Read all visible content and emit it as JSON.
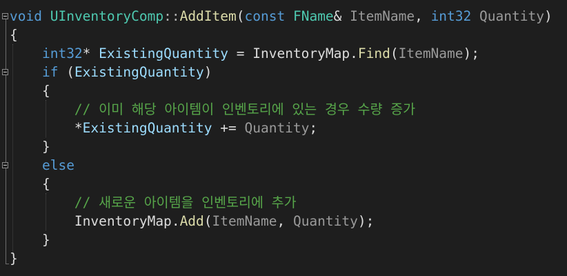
{
  "code_editor": {
    "lines": [
      {
        "tokens": [
          {
            "text": "void",
            "cls": "kw"
          },
          {
            "text": " ",
            "cls": "plain"
          },
          {
            "text": "UInventoryComp",
            "cls": "typ"
          },
          {
            "text": "::",
            "cls": "punc"
          },
          {
            "text": "AddItem",
            "cls": "fn"
          },
          {
            "text": "(",
            "cls": "plain"
          },
          {
            "text": "const",
            "cls": "kw"
          },
          {
            "text": " ",
            "cls": "plain"
          },
          {
            "text": "FName",
            "cls": "typ"
          },
          {
            "text": "& ",
            "cls": "plain"
          },
          {
            "text": "ItemName",
            "cls": "param"
          },
          {
            "text": ", ",
            "cls": "plain"
          },
          {
            "text": "int32",
            "cls": "kw"
          },
          {
            "text": " ",
            "cls": "plain"
          },
          {
            "text": "Quantity",
            "cls": "param"
          },
          {
            "text": ")",
            "cls": "plain"
          }
        ]
      },
      {
        "tokens": [
          {
            "text": "{",
            "cls": "plain"
          }
        ]
      },
      {
        "tokens": [
          {
            "text": "    ",
            "cls": "plain"
          },
          {
            "text": "int32",
            "cls": "kw"
          },
          {
            "text": "* ",
            "cls": "plain"
          },
          {
            "text": "ExistingQuantity",
            "cls": "var"
          },
          {
            "text": " = ",
            "cls": "plain"
          },
          {
            "text": "InventoryMap",
            "cls": "plain"
          },
          {
            "text": ".",
            "cls": "plain"
          },
          {
            "text": "Find",
            "cls": "fn"
          },
          {
            "text": "(",
            "cls": "plain"
          },
          {
            "text": "ItemName",
            "cls": "param"
          },
          {
            "text": ");",
            "cls": "plain"
          }
        ]
      },
      {
        "tokens": [
          {
            "text": "    ",
            "cls": "plain"
          },
          {
            "text": "if",
            "cls": "kw"
          },
          {
            "text": " (",
            "cls": "plain"
          },
          {
            "text": "ExistingQuantity",
            "cls": "var"
          },
          {
            "text": ")",
            "cls": "plain"
          }
        ]
      },
      {
        "tokens": [
          {
            "text": "    ",
            "cls": "plain"
          },
          {
            "text": "{",
            "cls": "plain"
          }
        ]
      },
      {
        "tokens": [
          {
            "text": "        ",
            "cls": "plain"
          },
          {
            "text": "// 이미 해당 아이템이 인벤토리에 있는 경우 수량 증가",
            "cls": "cmt"
          }
        ]
      },
      {
        "tokens": [
          {
            "text": "        ",
            "cls": "plain"
          },
          {
            "text": "*",
            "cls": "plain"
          },
          {
            "text": "ExistingQuantity",
            "cls": "var"
          },
          {
            "text": " += ",
            "cls": "plain"
          },
          {
            "text": "Quantity",
            "cls": "param"
          },
          {
            "text": ";",
            "cls": "plain"
          }
        ]
      },
      {
        "tokens": [
          {
            "text": "    ",
            "cls": "plain"
          },
          {
            "text": "}",
            "cls": "plain"
          }
        ]
      },
      {
        "tokens": [
          {
            "text": "    ",
            "cls": "plain"
          },
          {
            "text": "else",
            "cls": "kw"
          }
        ]
      },
      {
        "tokens": [
          {
            "text": "    ",
            "cls": "plain"
          },
          {
            "text": "{",
            "cls": "plain"
          }
        ]
      },
      {
        "tokens": [
          {
            "text": "        ",
            "cls": "plain"
          },
          {
            "text": "// 새로운 아이템을 인벤토리에 추가",
            "cls": "cmt"
          }
        ]
      },
      {
        "tokens": [
          {
            "text": "        ",
            "cls": "plain"
          },
          {
            "text": "InventoryMap",
            "cls": "plain"
          },
          {
            "text": ".",
            "cls": "plain"
          },
          {
            "text": "Add",
            "cls": "fn"
          },
          {
            "text": "(",
            "cls": "plain"
          },
          {
            "text": "ItemName",
            "cls": "param"
          },
          {
            "text": ", ",
            "cls": "plain"
          },
          {
            "text": "Quantity",
            "cls": "param"
          },
          {
            "text": ");",
            "cls": "plain"
          }
        ]
      },
      {
        "tokens": [
          {
            "text": "    ",
            "cls": "plain"
          },
          {
            "text": "}",
            "cls": "plain"
          }
        ]
      },
      {
        "tokens": [
          {
            "text": "}",
            "cls": "plain"
          }
        ]
      }
    ]
  }
}
